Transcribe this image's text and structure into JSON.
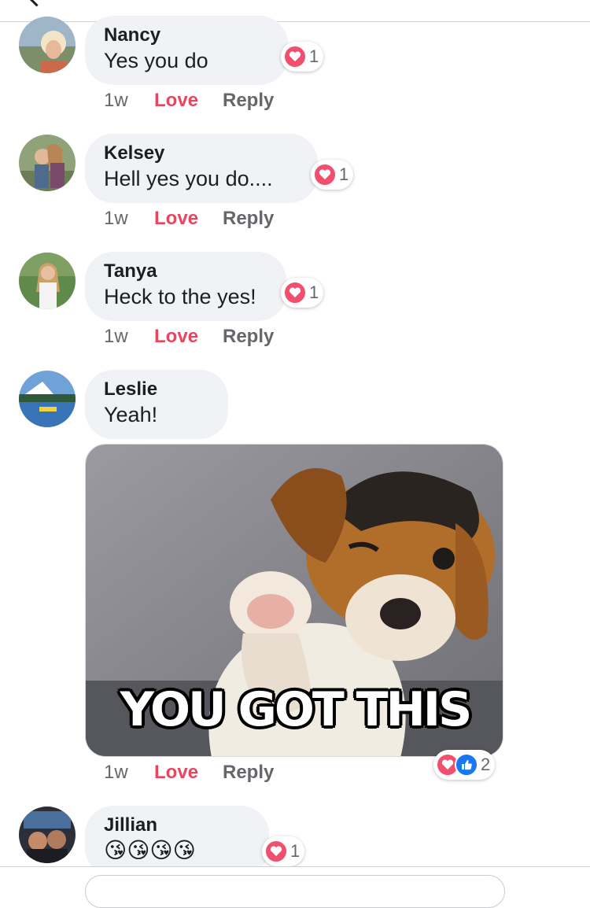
{
  "comments": [
    {
      "name": "Nancy",
      "text": "Yes you do",
      "time": "1w",
      "love": "Love",
      "reply": "Reply",
      "reaction_count": "1"
    },
    {
      "name": "Kelsey",
      "text": "Hell yes you do....",
      "time": "1w",
      "love": "Love",
      "reply": "Reply",
      "reaction_count": "1"
    },
    {
      "name": "Tanya",
      "text": "Heck to the yes!",
      "time": "1w",
      "love": "Love",
      "reply": "Reply",
      "reaction_count": "1"
    },
    {
      "name": "Leslie",
      "text": "Yeah!",
      "time": "1w",
      "love": "Love",
      "reply": "Reply",
      "reaction_count": "2",
      "image_caption": "YOU GOT THIS"
    },
    {
      "name": "Jillian",
      "text": "😘😘😘😘",
      "reaction_count": "1"
    }
  ],
  "colors": {
    "love": "#e9455f",
    "heart_badge": "#f0506e",
    "like_badge": "#1877f2",
    "bubble": "#f0f2f5"
  },
  "icons": {
    "heart": "heart-icon",
    "like": "thumbs-up-icon"
  }
}
